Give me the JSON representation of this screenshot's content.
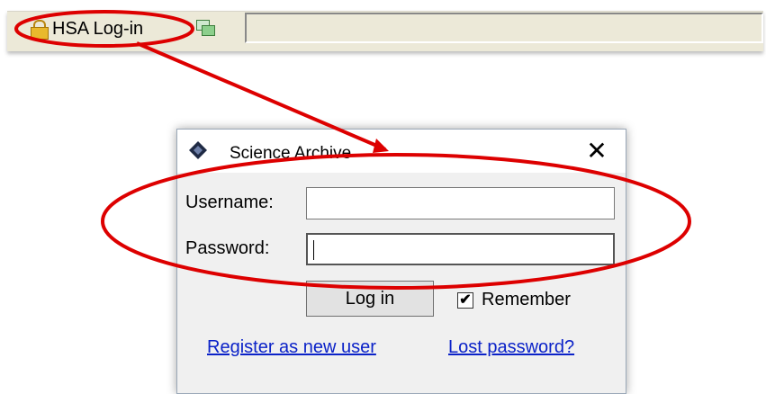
{
  "toolbar": {
    "login_label": "HSA Log-in",
    "status_text": ""
  },
  "dialog": {
    "title": "Science Archive",
    "close_symbol": "✕",
    "username_label": "Username:",
    "username_value": "",
    "password_label": "Password:",
    "password_value": "",
    "login_button": "Log in",
    "remember_label": "Remember",
    "remember_checked": true,
    "remember_check_mark": "✔",
    "register_link": "Register as new user",
    "lost_password_link": "Lost password?"
  },
  "icons": {
    "lock": "lock-icon",
    "windows": "windows-icon",
    "app": "science-archive-icon",
    "close": "close-icon"
  },
  "colors": {
    "annotation": "#dd0000",
    "link": "#0b22c8",
    "toolbar_bg": "#ece9d8"
  }
}
